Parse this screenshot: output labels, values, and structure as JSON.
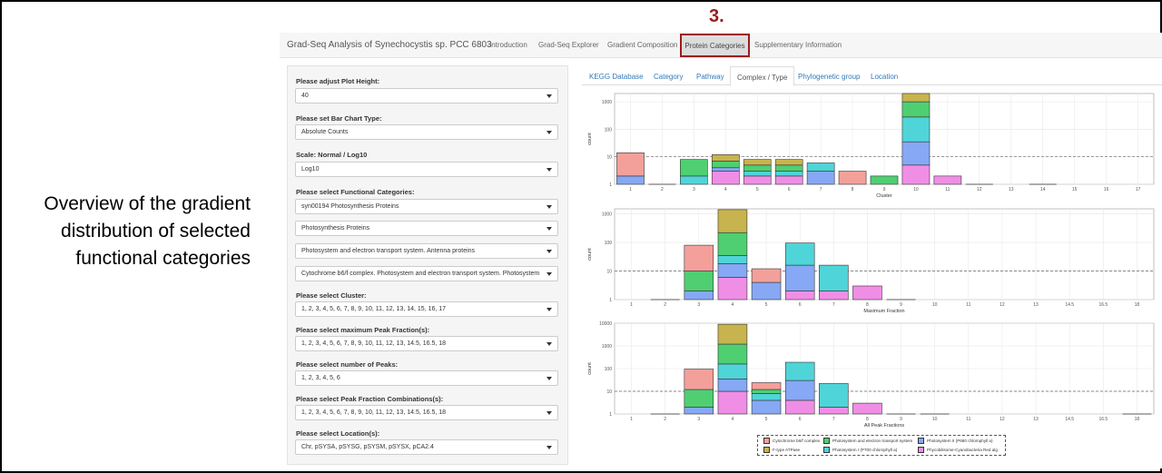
{
  "caption": [
    "Overview  of the gradient",
    "distribution of selected",
    "functional categories"
  ],
  "step_label": "3.",
  "app": {
    "title": "Grad-Seq Analysis of Synechocystis sp. PCC 6803",
    "nav": [
      "Introduction",
      "Grad-Seq Explorer",
      "Gradient Composition",
      "Protein Categories",
      "Supplementary Information"
    ],
    "active_nav": "Protein Categories"
  },
  "sidebar": {
    "plot_height_label": "Please adjust Plot Height:",
    "plot_height_value": "40",
    "bar_type_label": "Please set Bar Chart Type:",
    "bar_type_value": "Absolute Counts",
    "scale_label": "Scale: Normal / Log10",
    "scale_value": "Log10",
    "functional_label": "Please select Functional Categories:",
    "functional_values": [
      "syn00194 Photosynthesis Proteins",
      "Photosynthesis Proteins",
      "Photosystem and electron transport system. Antenna proteins",
      "Cytochrome b6/f complex. Photosystem and electron transport system. Photosystem"
    ],
    "cluster_label": "Please select Cluster:",
    "cluster_value": "1, 2, 3, 4, 5, 6, 7, 8, 9, 10, 11, 12, 13, 14, 15, 16, 17",
    "peak_label": "Please select maximum Peak Fraction(s):",
    "peak_value": "1, 2, 3, 4, 5, 6, 7, 8, 9, 10, 11, 12, 13, 14.5, 16.5, 18",
    "npeaks_label": "Please select number of Peaks:",
    "npeaks_value": "1, 2, 3, 4, 5, 6",
    "combo_label": "Please select Peak Fraction Combinations(s):",
    "combo_value": "1, 2, 3, 4, 5, 6, 7, 8, 9, 10, 11, 12, 13, 14.5, 16.5, 18",
    "location_label": "Please select Location(s):",
    "location_value": "Chr, pSYSA, pSYSG, pSYSM, pSYSX, pCA2.4"
  },
  "tabs": [
    "KEGG Database",
    "Category",
    "Pathway",
    "Complex / Type",
    "Phylogenetic group",
    "Location"
  ],
  "active_tab": "Complex / Type",
  "colors": {
    "cyt": "#f4a09a",
    "atp": "#c8b44e",
    "psets": "#4fcf72",
    "ps1": "#4fd5d8",
    "ps2": "#86a8f5",
    "phy": "#f08ee6",
    "grid": "#e6e6e6",
    "accent": "#9b1c1c"
  },
  "legend": [
    {
      "key": "cyt",
      "label": "Cytochrome b6/f complex"
    },
    {
      "key": "atp",
      "label": "F-type ATPase"
    },
    {
      "key": "psets",
      "label": "Photosystem and electron transport system"
    },
    {
      "key": "ps1",
      "label": "Photosystem I (P700 chlorophyll a)"
    },
    {
      "key": "ps2",
      "label": "Photosystem II (P680 chlorophyll a)"
    },
    {
      "key": "phy",
      "label": "Phycobilisome-Cyanobacteria Red alg"
    }
  ],
  "chart_data": [
    {
      "type": "bar",
      "stacked": true,
      "scale": "log10",
      "ylabel": "count",
      "xlabel": "Cluster",
      "yticks": [
        "1",
        "10",
        "100",
        "1000"
      ],
      "ylim": [
        1,
        2000
      ],
      "reference_line": 10,
      "categories": [
        "1",
        "2",
        "3",
        "4",
        "5",
        "6",
        "7",
        "8",
        "9",
        "10",
        "11",
        "12",
        "13",
        "14",
        "15",
        "16",
        "17"
      ],
      "bars": [
        {
          "x": "1",
          "segs": [
            [
              "ps2",
              2
            ],
            [
              "cyt",
              14
            ]
          ]
        },
        {
          "x": "2",
          "segs": [
            [
              "cyt",
              1
            ]
          ]
        },
        {
          "x": "3",
          "segs": [
            [
              "ps1",
              2
            ],
            [
              "psets",
              8
            ]
          ]
        },
        {
          "x": "4",
          "segs": [
            [
              "phy",
              3
            ],
            [
              "ps2",
              4
            ],
            [
              "psets",
              7
            ],
            [
              "atp",
              12
            ]
          ]
        },
        {
          "x": "5",
          "segs": [
            [
              "phy",
              2
            ],
            [
              "ps1",
              3
            ],
            [
              "psets",
              5
            ],
            [
              "atp",
              8
            ]
          ]
        },
        {
          "x": "6",
          "segs": [
            [
              "phy",
              2
            ],
            [
              "ps1",
              3
            ],
            [
              "psets",
              5
            ],
            [
              "atp",
              8
            ]
          ]
        },
        {
          "x": "7",
          "segs": [
            [
              "ps2",
              3
            ],
            [
              "ps1",
              6
            ]
          ]
        },
        {
          "x": "8",
          "segs": [
            [
              "cyt",
              3
            ]
          ]
        },
        {
          "x": "9",
          "segs": [
            [
              "psets",
              2
            ]
          ]
        },
        {
          "x": "10",
          "segs": [
            [
              "phy",
              5
            ],
            [
              "ps2",
              35
            ],
            [
              "ps1",
              280
            ],
            [
              "psets",
              1000
            ],
            [
              "atp",
              2000
            ]
          ]
        },
        {
          "x": "11",
          "segs": [
            [
              "phy",
              2
            ]
          ]
        },
        {
          "x": "12",
          "segs": [
            [
              "phy",
              1
            ]
          ]
        },
        {
          "x": "14",
          "segs": [
            [
              "phy",
              1
            ]
          ]
        }
      ]
    },
    {
      "type": "bar",
      "stacked": true,
      "scale": "log10",
      "ylabel": "count",
      "xlabel": "Maximum Fraction",
      "yticks": [
        "1",
        "10",
        "100",
        "1000"
      ],
      "ylim": [
        1,
        1500
      ],
      "reference_line": 10,
      "categories": [
        "1",
        "2",
        "3",
        "4",
        "5",
        "6",
        "7",
        "8",
        "9",
        "10",
        "11",
        "12",
        "13",
        "14.5",
        "16.5",
        "18"
      ],
      "bars": [
        {
          "x": "2",
          "segs": [
            [
              "cyt",
              1
            ]
          ]
        },
        {
          "x": "3",
          "segs": [
            [
              "ps2",
              2
            ],
            [
              "psets",
              10
            ],
            [
              "cyt",
              80
            ]
          ]
        },
        {
          "x": "4",
          "segs": [
            [
              "phy",
              6
            ],
            [
              "ps2",
              18
            ],
            [
              "ps1",
              35
            ],
            [
              "psets",
              220
            ],
            [
              "atp",
              1400
            ]
          ]
        },
        {
          "x": "5",
          "segs": [
            [
              "ps2",
              4
            ],
            [
              "cyt",
              12
            ]
          ]
        },
        {
          "x": "6",
          "segs": [
            [
              "phy",
              2
            ],
            [
              "ps2",
              16
            ],
            [
              "ps1",
              95
            ]
          ]
        },
        {
          "x": "7",
          "segs": [
            [
              "phy",
              2
            ],
            [
              "ps1",
              16
            ]
          ]
        },
        {
          "x": "8",
          "segs": [
            [
              "phy",
              3
            ]
          ]
        },
        {
          "x": "9",
          "segs": [
            [
              "phy",
              1
            ]
          ]
        }
      ]
    },
    {
      "type": "bar",
      "stacked": true,
      "scale": "log10",
      "ylabel": "count",
      "xlabel": "All Peak Fractions",
      "yticks": [
        "1",
        "10",
        "100",
        "1000",
        "10000"
      ],
      "ylim": [
        1,
        10000
      ],
      "reference_line": 10,
      "categories": [
        "1",
        "2",
        "3",
        "4",
        "5",
        "6",
        "7",
        "8",
        "9",
        "10",
        "11",
        "12",
        "13",
        "14.5",
        "16.5",
        "18"
      ],
      "bars": [
        {
          "x": "2",
          "segs": [
            [
              "cyt",
              1
            ]
          ]
        },
        {
          "x": "3",
          "segs": [
            [
              "ps2",
              2
            ],
            [
              "psets",
              12
            ],
            [
              "cyt",
              95
            ]
          ]
        },
        {
          "x": "4",
          "segs": [
            [
              "phy",
              10
            ],
            [
              "ps2",
              35
            ],
            [
              "ps1",
              160
            ],
            [
              "psets",
              1200
            ],
            [
              "atp",
              9000
            ]
          ]
        },
        {
          "x": "5",
          "segs": [
            [
              "ps2",
              4
            ],
            [
              "ps1",
              8
            ],
            [
              "psets",
              12
            ],
            [
              "cyt",
              24
            ]
          ]
        },
        {
          "x": "6",
          "segs": [
            [
              "phy",
              4
            ],
            [
              "ps2",
              30
            ],
            [
              "ps1",
              190
            ]
          ]
        },
        {
          "x": "7",
          "segs": [
            [
              "phy",
              2
            ],
            [
              "ps1",
              22
            ]
          ]
        },
        {
          "x": "8",
          "segs": [
            [
              "phy",
              3
            ]
          ]
        },
        {
          "x": "9",
          "segs": [
            [
              "phy",
              1
            ]
          ]
        },
        {
          "x": "10",
          "segs": [
            [
              "phy",
              1
            ]
          ]
        },
        {
          "x": "18",
          "segs": [
            [
              "phy",
              1
            ]
          ]
        }
      ]
    }
  ]
}
